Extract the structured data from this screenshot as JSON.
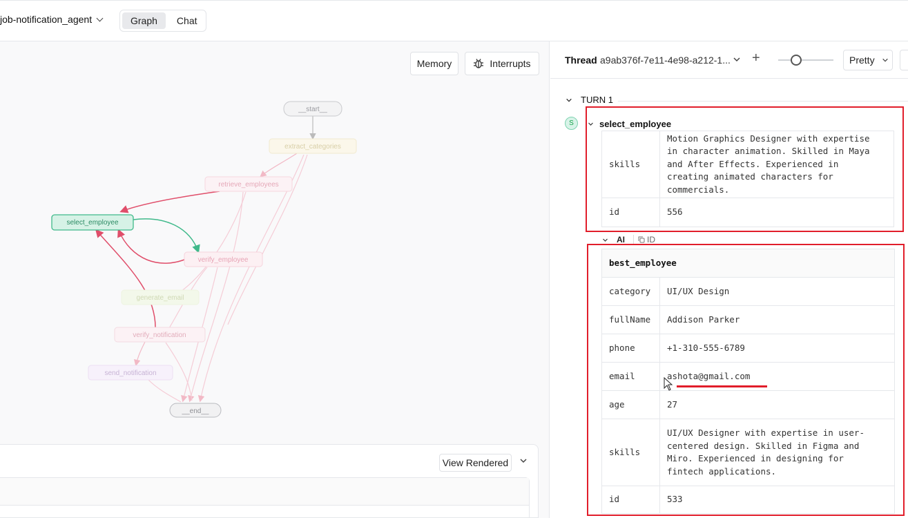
{
  "header": {
    "project": "job-notification_agent",
    "tabs": [
      {
        "label": "Graph",
        "active": true
      },
      {
        "label": "Chat",
        "active": false
      }
    ]
  },
  "graph": {
    "memory_label": "Memory",
    "interrupts_label": "Interrupts",
    "nodes": {
      "start": "__start__",
      "extract": "extract_categories",
      "retrieve": "retrieve_employees",
      "select": "select_employee",
      "verify": "verify_employee",
      "generate": "generate_email",
      "verify_notif": "verify_notification",
      "send": "send_notification",
      "end": "__end__"
    },
    "active_node": "select_employee",
    "view_label": "View Rendered"
  },
  "thread": {
    "label": "Thread",
    "id": "a9ab376f-7e11-4e98-a212-1...",
    "view_mode": "Pretty",
    "turn_label": "TURN 1",
    "node_badge": "S",
    "node_name": "select_employee",
    "prev_rows": [
      {
        "key": "skills",
        "lines": [
          "Motion Graphics Designer with expertise",
          "in character animation. Skilled in Maya",
          "and After Effects. Experienced in",
          "creating animated characters for",
          "commercials."
        ]
      },
      {
        "key": "id",
        "lines": [
          "556"
        ]
      }
    ],
    "ai_label": "AI",
    "id_label": "ID",
    "best_title": "best_employee",
    "best_rows": [
      {
        "key": "category",
        "lines": [
          "UI/UX Design"
        ]
      },
      {
        "key": "fullName",
        "lines": [
          "Addison Parker"
        ]
      },
      {
        "key": "phone",
        "lines": [
          "+1-310-555-6789"
        ]
      },
      {
        "key": "email",
        "lines": [
          "ashota@gmail.com"
        ]
      },
      {
        "key": "age",
        "lines": [
          "27"
        ]
      },
      {
        "key": "skills",
        "lines": [
          "UI/UX Designer with expertise in user-",
          "centered design. Skilled in Figma and",
          "Miro. Experienced in designing for",
          "fintech applications."
        ]
      },
      {
        "key": "id",
        "lines": [
          "533"
        ]
      }
    ]
  },
  "colors": {
    "active_node": "#3fb98a",
    "highlight": "#e11d2a",
    "edge_red": "#e04e6a"
  }
}
